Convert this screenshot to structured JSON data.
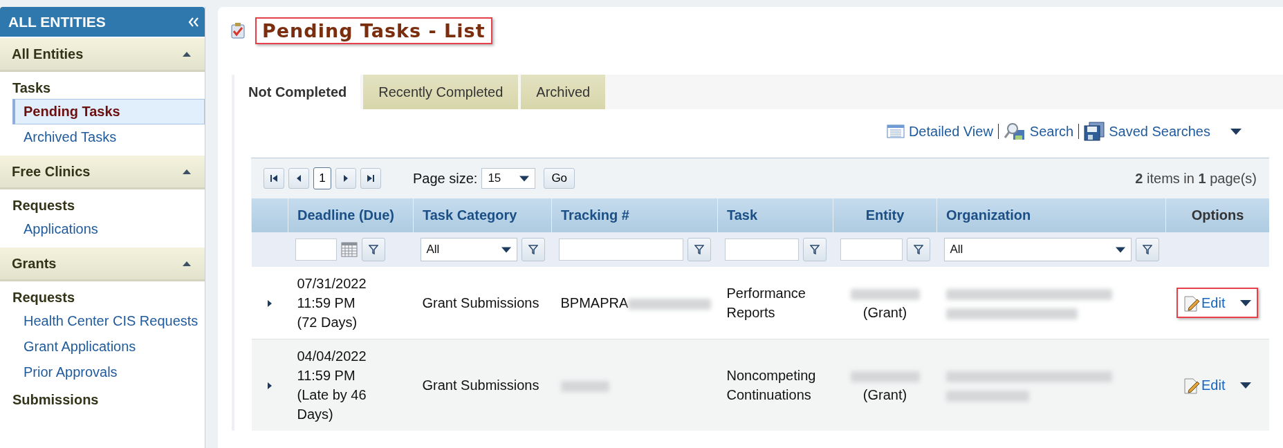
{
  "sidebar": {
    "title": "ALL ENTITIES",
    "sections": [
      {
        "title": "All Entities",
        "expanded": true,
        "groups": [
          {
            "heading": "Tasks",
            "items": [
              {
                "label": "Pending Tasks",
                "selected": true
              },
              {
                "label": "Archived Tasks",
                "selected": false
              }
            ]
          }
        ]
      },
      {
        "title": "Free Clinics",
        "expanded": true,
        "groups": [
          {
            "heading": "Requests",
            "items": [
              {
                "label": "Applications",
                "selected": false
              }
            ]
          }
        ]
      },
      {
        "title": "Grants",
        "expanded": true,
        "groups": [
          {
            "heading": "Requests",
            "items": [
              {
                "label": "Health Center CIS Requests",
                "selected": false
              },
              {
                "label": "Grant Applications",
                "selected": false
              },
              {
                "label": "Prior Approvals",
                "selected": false
              }
            ]
          },
          {
            "heading": "Submissions"
          }
        ]
      }
    ]
  },
  "page": {
    "title": "Pending Tasks - List",
    "highlighted": true
  },
  "tabs": [
    {
      "label": "Not Completed",
      "selected": true
    },
    {
      "label": "Recently Completed",
      "selected": false
    },
    {
      "label": "Archived",
      "selected": false
    }
  ],
  "toolbar": [
    {
      "kind": "list",
      "label": "Detailed View"
    },
    {
      "kind": "search",
      "label": "Search"
    },
    {
      "kind": "save",
      "label": "Saved Searches"
    }
  ],
  "pager": {
    "current_page": "1",
    "page_size_label": "Page size:",
    "page_size": "15",
    "go": "Go",
    "summary": "**2** items in **1** page(s)"
  },
  "table": {
    "columns": [
      "Deadline (Due)",
      "Task Category",
      "Tracking #",
      "Task",
      "Entity",
      "Organization",
      "Options"
    ],
    "filters": [
      {
        "kind": "date"
      },
      {
        "kind": "select",
        "value": "All"
      },
      {
        "kind": "text"
      },
      {
        "kind": "text"
      },
      {
        "kind": "text"
      },
      {
        "kind": "select",
        "value": "All"
      }
    ],
    "rows": [
      {
        "deadline": [
          "07/31/2022",
          "11:59 PM",
          "(72 Days)"
        ],
        "category": "Grant Submissions",
        "tracking": "BPMAPRA",
        "task": "Performance Reports",
        "entity": "(Grant)",
        "option": {
          "label": "Edit",
          "highlighted": true
        }
      },
      {
        "deadline": [
          "04/04/2022",
          "11:59 PM",
          "(Late by 46 Days)"
        ],
        "category": "Grant Submissions",
        "tracking": "",
        "task": "Noncompeting Continuations",
        "entity": "(Grant)",
        "option": {
          "label": "Edit",
          "highlighted": false
        }
      }
    ]
  }
}
